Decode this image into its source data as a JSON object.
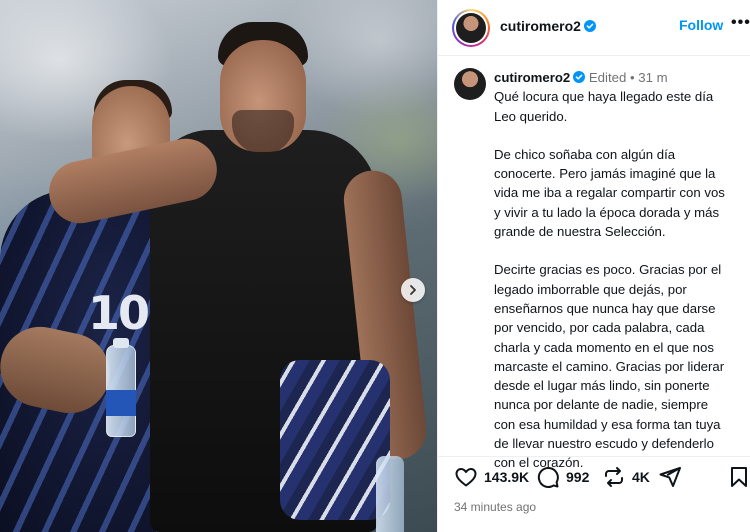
{
  "post": {
    "username": "cutiromero2",
    "follow_label": "Follow",
    "more_label": "•••",
    "caption": {
      "username": "cutiromero2",
      "edited_label": "Edited",
      "separator": "•",
      "time": "31 m",
      "paragraphs": [
        "Qué locura que haya llegado este día\nLeo querido.",
        "De chico soñaba con algún día\nconocerte. Pero jamás imaginé que la\nvida me iba a regalar compartir con vos\ny vivir a tu lado la época dorada y más\ngrande  de nuestra Selección.",
        "Decirte gracias es poco. Gracias por el\nlegado imborrable que dejás, por\nenseñarnos que nunca hay que darse\npor vencido, por cada palabra, cada\ncharla y cada momento en el que nos\nmarcaste el camino. Gracias por liderar\ndesde el lugar más lindo, sin ponerte\nnunca por delante de nadie, siempre\ncon esa humildad y esa forma tan tuya\nde llevar nuestro escudo y defenderlo\ncon el corazón."
      ]
    },
    "stats": {
      "likes": "143.9K",
      "comments": "992",
      "reposts": "4K"
    },
    "time_ago": "34 minutes ago",
    "jersey_number": "10"
  },
  "icons": {
    "verified": "verified-badge-icon",
    "like": "heart-icon",
    "comment": "comment-bubble-icon",
    "repost": "repost-icon",
    "share": "send-icon",
    "save": "bookmark-icon",
    "next": "chevron-right-icon"
  },
  "colors": {
    "accent": "#0095f6",
    "muted": "#737373",
    "text": "#0f1419"
  }
}
